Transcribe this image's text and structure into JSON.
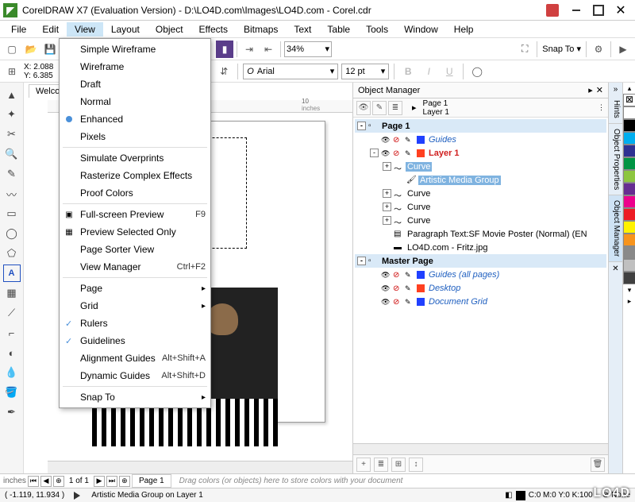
{
  "titlebar": {
    "app": "CorelDRAW X7 (Evaluation Version)",
    "path": "D:\\LO4D.com\\Images\\LO4D.com - Corel.cdr"
  },
  "menubar": [
    "File",
    "Edit",
    "View",
    "Layout",
    "Object",
    "Effects",
    "Bitmaps",
    "Text",
    "Table",
    "Tools",
    "Window",
    "Help"
  ],
  "menubar_open_index": 2,
  "toolbar": {
    "zoom": "34%",
    "snap_to": "Snap To"
  },
  "propbar": {
    "x_label": "X:",
    "y_label": "Y:",
    "x": "2.088",
    "y": "6.385",
    "font": "Arial",
    "font_size": "12 pt",
    "font_prefix": "O"
  },
  "canvas": {
    "welcome_tab": "Welcom",
    "ruler_mark": "10",
    "ruler_unit": "inches",
    "ruler_left_unit": "inches"
  },
  "view_menu": {
    "items": [
      {
        "label": "Simple Wireframe"
      },
      {
        "label": "Wireframe"
      },
      {
        "label": "Draft"
      },
      {
        "label": "Normal"
      },
      {
        "label": "Enhanced",
        "radio": true
      },
      {
        "label": "Pixels"
      },
      {
        "sep": true
      },
      {
        "label": "Simulate Overprints"
      },
      {
        "label": "Rasterize Complex Effects"
      },
      {
        "label": "Proof Colors"
      },
      {
        "sep": true
      },
      {
        "label": "Full-screen Preview",
        "shortcut": "F9",
        "icon": "▣"
      },
      {
        "label": "Preview Selected Only",
        "icon": "▦"
      },
      {
        "label": "Page Sorter View"
      },
      {
        "label": "View Manager",
        "shortcut": "Ctrl+F2"
      },
      {
        "sep": true
      },
      {
        "label": "Page",
        "submenu": true
      },
      {
        "label": "Grid",
        "submenu": true
      },
      {
        "label": "Rulers",
        "check": true
      },
      {
        "label": "Guidelines",
        "check": true
      },
      {
        "label": "Alignment Guides",
        "shortcut": "Alt+Shift+A"
      },
      {
        "label": "Dynamic Guides",
        "shortcut": "Alt+Shift+D"
      },
      {
        "sep": true
      },
      {
        "label": "Snap To",
        "submenu": true
      }
    ]
  },
  "docker": {
    "title": "Object Manager",
    "page_label": "Page 1",
    "layer_label": "Layer 1",
    "tree": [
      {
        "type": "header",
        "label": "Page 1",
        "exp": "-",
        "indent": 0
      },
      {
        "type": "layer",
        "label": "Guides",
        "italic": true,
        "swatch": "#2040ff",
        "exp": null,
        "indent": 1
      },
      {
        "type": "layer",
        "label": "Layer 1",
        "red": true,
        "swatch": "#ff4020",
        "exp": "-",
        "indent": 1
      },
      {
        "type": "obj",
        "label": "Curve",
        "selected": true,
        "icon": "curve",
        "indent": 2,
        "exp": "+"
      },
      {
        "type": "obj",
        "label": "Artistic Media Group",
        "selected": true,
        "icon": "brush",
        "indent": 3
      },
      {
        "type": "obj",
        "label": "Curve",
        "icon": "curve",
        "indent": 2,
        "exp": "+"
      },
      {
        "type": "obj",
        "label": "Curve",
        "icon": "curve",
        "indent": 2,
        "exp": "+"
      },
      {
        "type": "obj",
        "label": "Curve",
        "icon": "curve",
        "indent": 2,
        "exp": "+"
      },
      {
        "type": "obj",
        "label": "Paragraph Text:SF Movie Poster (Normal) (EN",
        "icon": "text",
        "indent": 2
      },
      {
        "type": "obj",
        "label": "LO4D.com - Fritz.jpg",
        "icon": "image",
        "indent": 2
      },
      {
        "type": "header",
        "label": "Master Page",
        "exp": "-",
        "indent": 0
      },
      {
        "type": "layer",
        "label": "Guides (all pages)",
        "italic": true,
        "swatch": "#2040ff",
        "indent": 1
      },
      {
        "type": "layer",
        "label": "Desktop",
        "italic": true,
        "swatch": "#ff4020",
        "indent": 1
      },
      {
        "type": "layer",
        "label": "Document Grid",
        "italic": true,
        "swatch": "#2040ff",
        "indent": 1
      }
    ]
  },
  "right_tabs": [
    "Hints",
    "Object Properties",
    "Object Manager"
  ],
  "right_tabs_active": 2,
  "swatches": [
    "#ffffff",
    "#000000",
    "#00aeef",
    "#2e3192",
    "#009444",
    "#8dc63f",
    "#662d91",
    "#ec008c",
    "#ed1c24",
    "#fff200",
    "#f7941d",
    "#898989",
    "#c0c0c0",
    "#404040"
  ],
  "pagebar": {
    "pos": "1 of 1",
    "page": "Page 1",
    "hint": "Drag colors (or objects) here to store colors with your document"
  },
  "statusbar": {
    "coords": "( -1.119, 11.934 )",
    "selection": "Artistic Media Group on Layer 1",
    "fill": "C:0 M:0 Y:0 K:100",
    "outline": "None",
    "outline_icon": "⊗"
  },
  "brand": "LO4D"
}
